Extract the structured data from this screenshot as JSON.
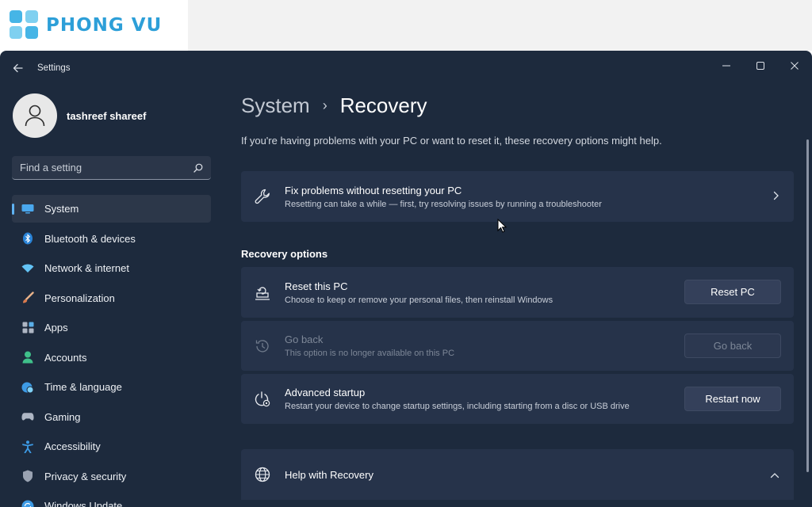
{
  "watermark": {
    "brand": "PHONG VU"
  },
  "window": {
    "title": "Settings"
  },
  "profile": {
    "name": "tashreef shareef"
  },
  "search": {
    "placeholder": "Find a setting"
  },
  "nav": {
    "items": [
      {
        "label": "System",
        "icon": "monitor-icon",
        "active": true
      },
      {
        "label": "Bluetooth & devices",
        "icon": "bluetooth-icon"
      },
      {
        "label": "Network & internet",
        "icon": "wifi-icon"
      },
      {
        "label": "Personalization",
        "icon": "brush-icon"
      },
      {
        "label": "Apps",
        "icon": "apps-icon"
      },
      {
        "label": "Accounts",
        "icon": "person-icon"
      },
      {
        "label": "Time & language",
        "icon": "globe-clock-icon"
      },
      {
        "label": "Gaming",
        "icon": "gamepad-icon"
      },
      {
        "label": "Accessibility",
        "icon": "accessibility-icon"
      },
      {
        "label": "Privacy & security",
        "icon": "shield-icon"
      },
      {
        "label": "Windows Update",
        "icon": "update-icon"
      }
    ]
  },
  "breadcrumb": {
    "parent": "System",
    "current": "Recovery"
  },
  "description": "If you're having problems with your PC or want to reset it, these recovery options might help.",
  "fix_card": {
    "title": "Fix problems without resetting your PC",
    "subtitle": "Resetting can take a while — first, try resolving issues by running a troubleshooter"
  },
  "recovery_options": {
    "heading": "Recovery options",
    "items": [
      {
        "title": "Reset this PC",
        "subtitle": "Choose to keep or remove your personal files, then reinstall Windows",
        "button": "Reset PC",
        "enabled": true
      },
      {
        "title": "Go back",
        "subtitle": "This option is no longer available on this PC",
        "button": "Go back",
        "enabled": false
      },
      {
        "title": "Advanced startup",
        "subtitle": "Restart your device to change startup settings, including starting from a disc or USB drive",
        "button": "Restart now",
        "enabled": true
      }
    ]
  },
  "help": {
    "title": "Help with Recovery"
  },
  "colors": {
    "accent": "#5fb2f2",
    "window_bg": "#1d2a3d",
    "card_bg": "#26334a",
    "brand": "#2d9fd8"
  }
}
